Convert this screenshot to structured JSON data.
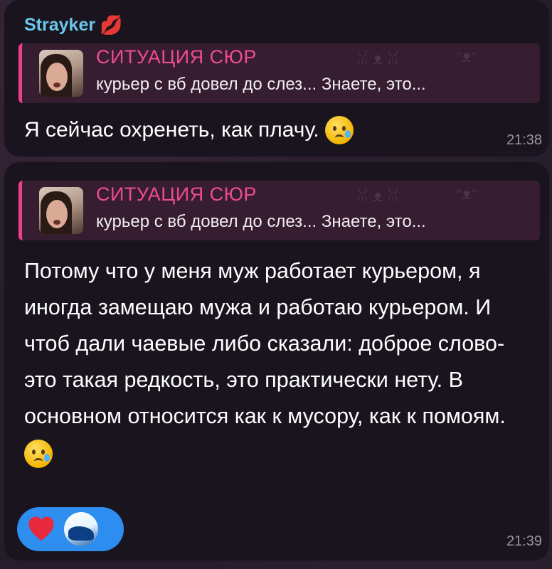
{
  "message1": {
    "sender": "Strayker",
    "sender_emoji": "💋",
    "reply": {
      "title": "СИТУАЦИЯ СЮР",
      "text": "курьер с вб довел до слез... Знаете, это..."
    },
    "text": "Я сейчас охренеть, как плачу.",
    "emoji": "crying-face-icon",
    "time": "21:38"
  },
  "message2": {
    "reply": {
      "title": "СИТУАЦИЯ СЮР",
      "text": "курьер с вб довел до слез... Знаете, это..."
    },
    "text": "Потому что у меня муж работает курьером, я иногда замещаю мужа и работаю курьером. И чтоб дали чаевые либо сказали: доброе слово-это такая редкость, это практически нету. В основном относится как к мусору, как к помоям.",
    "emoji": "crying-face-icon",
    "reaction": {
      "icon": "heart-icon",
      "color": "#2d8ef0"
    },
    "time": "21:39"
  },
  "colors": {
    "sender": "#6cc7ea",
    "reply_accent": "#ee3f88",
    "bubble": "#19141e"
  }
}
